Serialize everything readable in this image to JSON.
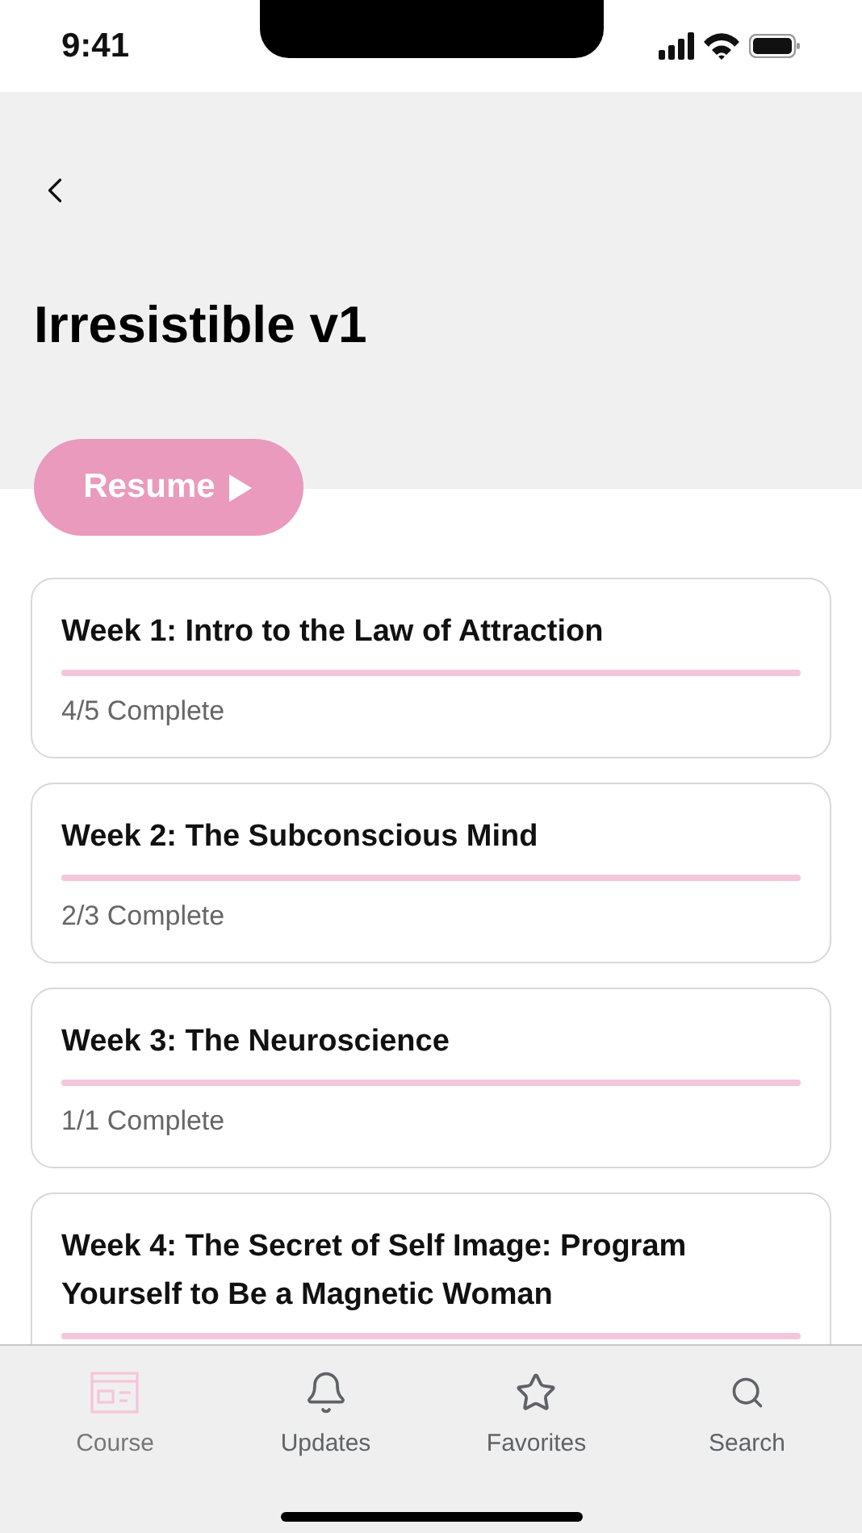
{
  "status_bar": {
    "time": "9:41"
  },
  "header": {
    "title": "Irresistible v1",
    "resume_button": "Resume"
  },
  "weeks": [
    {
      "title": "Week 1: Intro to the Law of Attraction",
      "level": 1,
      "progress": "4/5 Complete"
    },
    {
      "title": "Week 2: The Subconscious Mind",
      "level": 1,
      "progress": "2/3 Complete"
    },
    {
      "title": "Week 3: The Neuroscience",
      "level": 1,
      "progress": "1/1 Complete"
    },
    {
      "title": "Week 4: The Secret of Self Image: Program Yourself to Be a Magnetic Woman",
      "level": 1
    }
  ],
  "tab_bar": [
    {
      "label": "Course",
      "kind": "course",
      "selected": true
    },
    {
      "label": "Updates",
      "kind": "bell",
      "selected": false
    },
    {
      "label": "Favorites",
      "kind": "star",
      "selected": false
    },
    {
      "label": "Search",
      "kind": "search",
      "selected": false
    }
  ]
}
